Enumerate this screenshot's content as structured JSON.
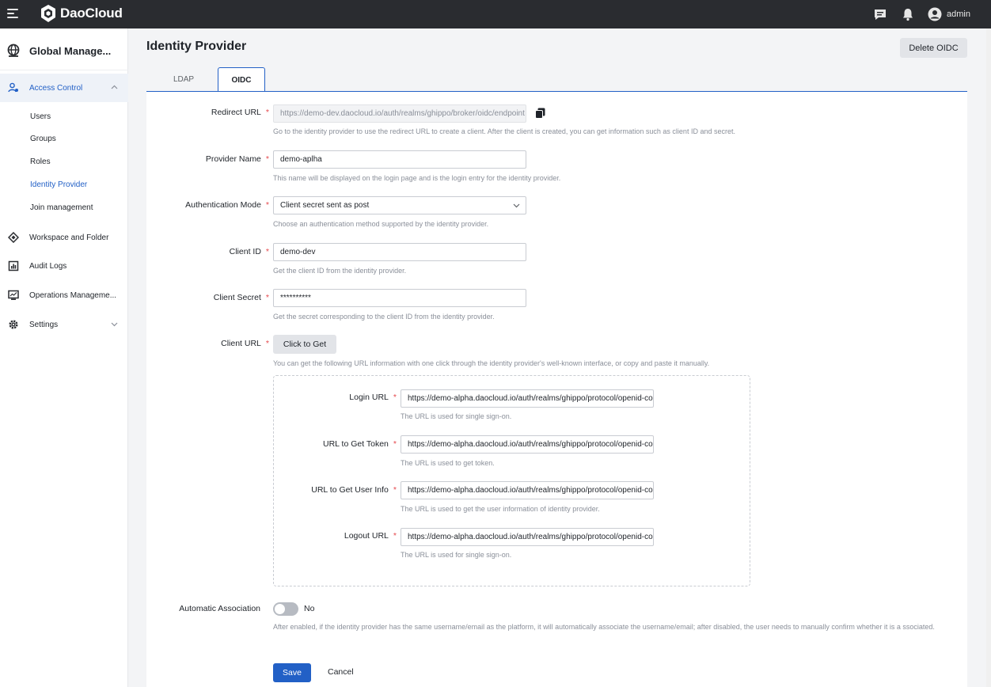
{
  "topbar": {
    "brand": "DaoCloud",
    "user": "admin",
    "icons": [
      "menu-icon",
      "message-icon",
      "bell-icon",
      "user-avatar-icon"
    ]
  },
  "sidebar": {
    "app_title": "Global Manage...",
    "groups": [
      {
        "label": "Access Control",
        "icon": "access-control-icon",
        "expanded": true
      },
      {
        "label": "Workspace and Folder",
        "icon": "workspace-icon"
      },
      {
        "label": "Audit Logs",
        "icon": "audit-log-icon"
      },
      {
        "label": "Operations Manageme...",
        "icon": "operations-icon"
      },
      {
        "label": "Settings",
        "icon": "gear-icon"
      }
    ],
    "access_items": [
      "Users",
      "Groups",
      "Roles",
      "Identity Provider",
      "Join management"
    ],
    "active_item": "Identity Provider"
  },
  "header": {
    "title": "Identity Provider",
    "delete_button": "Delete OIDC"
  },
  "tabs": [
    {
      "label": "LDAP",
      "active": false
    },
    {
      "label": "OIDC",
      "active": true
    }
  ],
  "form": {
    "redirect_url": {
      "label": "Redirect URL",
      "value": "https://demo-dev.daocloud.io/auth/realms/ghippo/broker/oidc/endpoint",
      "hint": "Go to the identity provider to use the redirect URL to create a client. After the client is created, you can get information such as client ID and secret."
    },
    "provider_name": {
      "label": "Provider Name",
      "value": "demo-aplha",
      "hint": "This name will be displayed on the login page and is the login entry for the identity provider."
    },
    "auth_mode": {
      "label": "Authentication Mode",
      "value": "Client secret sent as post",
      "hint": "Choose an authentication method supported by the identity provider."
    },
    "client_id": {
      "label": "Client ID",
      "value": "demo-dev",
      "hint": "Get the client ID from the identity provider."
    },
    "client_secret": {
      "label": "Client Secret",
      "value": "**********",
      "hint": "Get the secret corresponding to the client ID from the identity provider."
    },
    "client_url": {
      "label": "Client URL",
      "button": "Click to Get",
      "hint": "You can get the following URL information with one click through the identity provider's well-known interface, or copy and paste it manually."
    },
    "urls": {
      "login": {
        "label": "Login URL",
        "value": "https://demo-alpha.daocloud.io/auth/realms/ghippo/protocol/openid-connect/auth",
        "hint": "The URL is used for single sign-on."
      },
      "token": {
        "label": "URL to Get Token",
        "value": "https://demo-alpha.daocloud.io/auth/realms/ghippo/protocol/openid-connect/token",
        "hint": "The URL is used to get token."
      },
      "userinfo": {
        "label": "URL to Get User Info",
        "value": "https://demo-alpha.daocloud.io/auth/realms/ghippo/protocol/openid-connect/userinfo",
        "hint": "The URL is used to get the user information of identity provider."
      },
      "logout": {
        "label": "Logout URL",
        "value": "https://demo-alpha.daocloud.io/auth/realms/ghippo/protocol/openid-connect/logout",
        "hint": "The URL is used for single sign-on."
      }
    },
    "auto_association": {
      "label": "Automatic Association",
      "state": "No",
      "enabled": false,
      "hint": "After enabled, if the identity provider has the same username/email as the platform, it will automatically associate the username/email; after disabled, the user needs to manually confirm whether it is a ssociated."
    },
    "save_button": "Save",
    "cancel_button": "Cancel"
  },
  "colors": {
    "accent": "#2260c6",
    "topbar": "#2a2c30",
    "required": "#e5484d"
  }
}
